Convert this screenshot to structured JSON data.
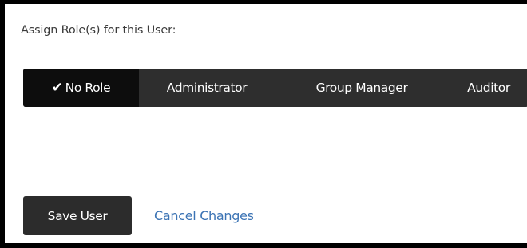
{
  "form": {
    "heading": "Assign Role(s) for this User:",
    "roles": [
      {
        "label": "No Role",
        "selected": true
      },
      {
        "label": "Administrator",
        "selected": false
      },
      {
        "label": "Group Manager",
        "selected": false
      },
      {
        "label": "Auditor",
        "selected": false
      }
    ],
    "save_label": "Save User",
    "cancel_label": "Cancel Changes"
  },
  "icons": {
    "selected_indicator": "checkmark-icon"
  },
  "colors": {
    "button_bg": "#2e2e2e",
    "selected_bg": "#0d0d0d",
    "link": "#3b73b4",
    "text": "#3a3a3a"
  }
}
